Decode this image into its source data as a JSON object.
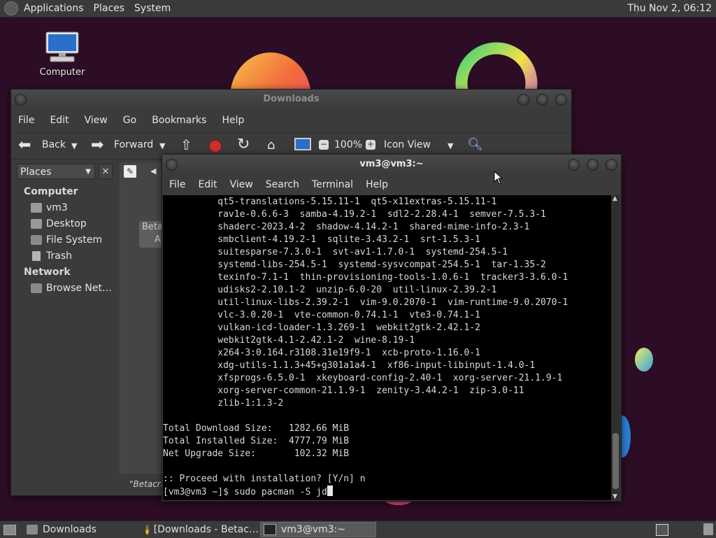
{
  "top_panel": {
    "menus": [
      "Applications",
      "Places",
      "System"
    ],
    "clock": "Thu Nov 2, 06:12"
  },
  "desktop": {
    "icons": [
      {
        "label": "Computer",
        "icon": "computer-icon"
      }
    ]
  },
  "file_manager": {
    "title": "Downloads",
    "menu": [
      "File",
      "Edit",
      "View",
      "Go",
      "Bookmarks",
      "Help"
    ],
    "toolbar": {
      "back": "Back",
      "forward": "Forward",
      "zoom": "100%",
      "view_mode": "Icon View"
    },
    "sidebar": {
      "selector": "Places",
      "sections": [
        {
          "heading": "Computer",
          "items": [
            "vm3",
            "Desktop",
            "File System",
            "Trash"
          ]
        },
        {
          "heading": "Network",
          "items": [
            "Browse Net…"
          ]
        }
      ]
    },
    "partial_item": {
      "line1": "Betaca",
      "line2": "A"
    },
    "status": "\"Betacra"
  },
  "terminal": {
    "title": "vm3@vm3:~",
    "menu": [
      "File",
      "Edit",
      "View",
      "Search",
      "Terminal",
      "Help"
    ],
    "lines": [
      "          qt5-translations-5.15.11-1  qt5-x11extras-5.15.11-1",
      "          rav1e-0.6.6-3  samba-4.19.2-1  sdl2-2.28.4-1  semver-7.5.3-1",
      "          shaderc-2023.4-2  shadow-4.14.2-1  shared-mime-info-2.3-1",
      "          smbclient-4.19.2-1  sqlite-3.43.2-1  srt-1.5.3-1",
      "          suitesparse-7.3.0-1  svt-av1-1.7.0-1  systemd-254.5-1",
      "          systemd-libs-254.5-1  systemd-sysvcompat-254.5-1  tar-1.35-2",
      "          texinfo-7.1-1  thin-provisioning-tools-1.0.6-1  tracker3-3.6.0-1",
      "          udisks2-2.10.1-2  unzip-6.0-20  util-linux-2.39.2-1",
      "          util-linux-libs-2.39.2-1  vim-9.0.2070-1  vim-runtime-9.0.2070-1",
      "          vlc-3.0.20-1  vte-common-0.74.1-1  vte3-0.74.1-1",
      "          vulkan-icd-loader-1.3.269-1  webkit2gtk-2.42.1-2",
      "          webkit2gtk-4.1-2.42.1-2  wine-8.19-1",
      "          x264-3:0.164.r3108.31e19f9-1  xcb-proto-1.16.0-1",
      "          xdg-utils-1.1.3+45+g301a1a4-1  xf86-input-libinput-1.4.0-1",
      "          xfsprogs-6.5.0-1  xkeyboard-config-2.40-1  xorg-server-21.1.9-1",
      "          xorg-server-common-21.1.9-1  zenity-3.44.2-1  zip-3.0-11",
      "          zlib-1:1.3-2",
      "",
      "Total Download Size:   1282.66 MiB",
      "Total Installed Size:  4777.79 MiB",
      "Net Upgrade Size:       102.32 MiB",
      "",
      ":: Proceed with installation? [Y/n] n",
      "[vm3@vm3 ~]$ sudo pacman -S jd"
    ]
  },
  "taskbar": {
    "tasks": [
      {
        "label": "Downloads",
        "icon": "folder-icon"
      },
      {
        "label": "[Downloads - Betac…",
        "icon": "chrome-icon"
      },
      {
        "label": "vm3@vm3:~",
        "icon": "terminal-icon"
      }
    ]
  },
  "colors": {
    "wallpaper": "#2c0d25",
    "panel": "#3a3a3a",
    "terminal_bg": "#000000",
    "terminal_fg": "#d8d8d8"
  }
}
